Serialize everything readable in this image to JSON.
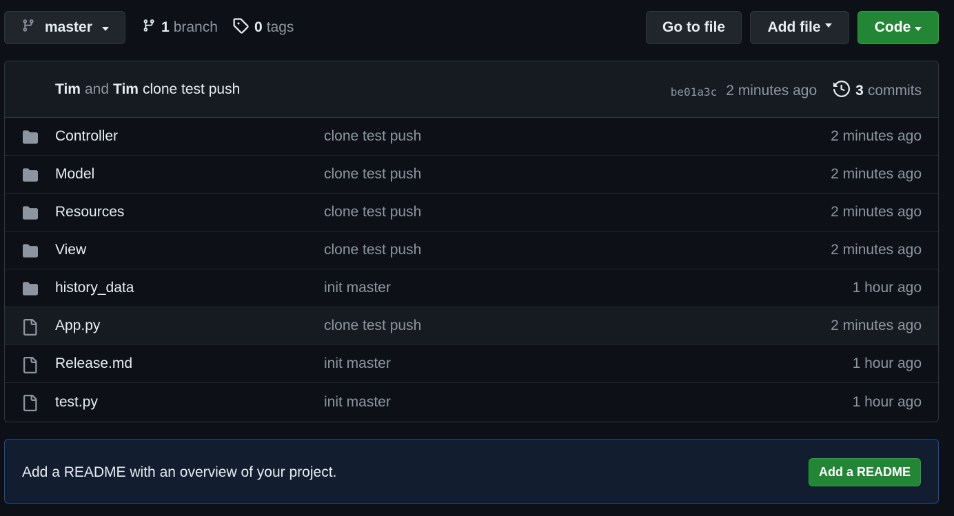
{
  "toolbar": {
    "branch_label": "master",
    "branch_count": "1",
    "branch_word": "branch",
    "tag_count": "0",
    "tag_word": "tags",
    "goto_label": "Go to file",
    "addfile_label": "Add file",
    "code_label": "Code"
  },
  "latest_commit": {
    "author1": "Tim",
    "and_word": "and",
    "author2": "Tim",
    "message": "clone test push",
    "sha": "be01a3c",
    "time": "2 minutes ago",
    "commit_count": "3",
    "commit_word": "commits"
  },
  "files": [
    {
      "type": "folder",
      "name": "Controller",
      "message": "clone test push",
      "age": "2 minutes ago"
    },
    {
      "type": "folder",
      "name": "Model",
      "message": "clone test push",
      "age": "2 minutes ago"
    },
    {
      "type": "folder",
      "name": "Resources",
      "message": "clone test push",
      "age": "2 minutes ago"
    },
    {
      "type": "folder",
      "name": "View",
      "message": "clone test push",
      "age": "2 minutes ago"
    },
    {
      "type": "folder",
      "name": "history_data",
      "message": "init master",
      "age": "1 hour ago"
    },
    {
      "type": "file",
      "name": "App.py",
      "message": "clone test push",
      "age": "2 minutes ago"
    },
    {
      "type": "file",
      "name": "Release.md",
      "message": "init master",
      "age": "1 hour ago"
    },
    {
      "type": "file",
      "name": "test.py",
      "message": "init master",
      "age": "1 hour ago"
    }
  ],
  "readme": {
    "text": "Add a README with an overview of your project.",
    "button_label": "Add a README"
  },
  "colors": {
    "background": "#0d1117",
    "primary_button": "#238636",
    "muted_text": "#8d96a0"
  }
}
